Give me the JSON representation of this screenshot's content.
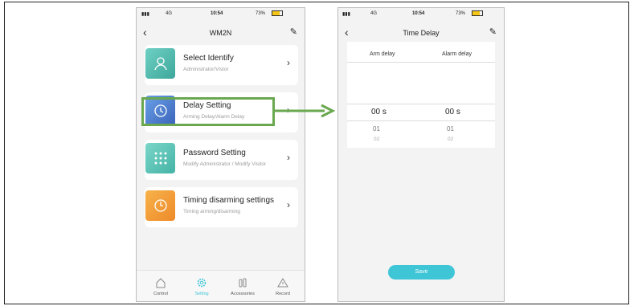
{
  "left_screen": {
    "status": {
      "signal": "4G",
      "time": "10:54",
      "battery": "73%"
    },
    "title": "WM2N",
    "cards": [
      {
        "title": "Select Identify",
        "subtitle": "Administrator/Vistor",
        "icon": "user-icon",
        "color": "#5bbfb4"
      },
      {
        "title": "Delay Setting",
        "subtitle": "Arming Delay/Alarm Delay",
        "icon": "timer-icon",
        "color": "#4a7fd0"
      },
      {
        "title": "Password Setting",
        "subtitle": "Modify Administrator / Modify Visitor",
        "icon": "keypad-icon",
        "color": "#5cc7b8"
      },
      {
        "title": "Timing disarming settings",
        "subtitle": "Timing arming/disarming",
        "icon": "clock-icon",
        "color": "#f0a23a"
      }
    ],
    "tabs": [
      {
        "label": "Control",
        "icon": "home-icon"
      },
      {
        "label": "Setting",
        "icon": "gear-icon",
        "active": true
      },
      {
        "label": "Accessories",
        "icon": "accessories-icon"
      },
      {
        "label": "Record",
        "icon": "alert-icon"
      }
    ],
    "highlight_color": "#6aa84f"
  },
  "right_screen": {
    "status": {
      "signal": "4G",
      "time": "10:54",
      "battery": "73%"
    },
    "title": "Time Delay",
    "columns": [
      "Arm delay",
      "Alarm delay"
    ],
    "picker": {
      "arm": {
        "selected": "00 s",
        "next1": "01",
        "next2": "02"
      },
      "alarm": {
        "selected": "00 s",
        "next1": "01",
        "next2": "02"
      }
    },
    "save_label": "Save",
    "accent": "#3ec5d6"
  }
}
